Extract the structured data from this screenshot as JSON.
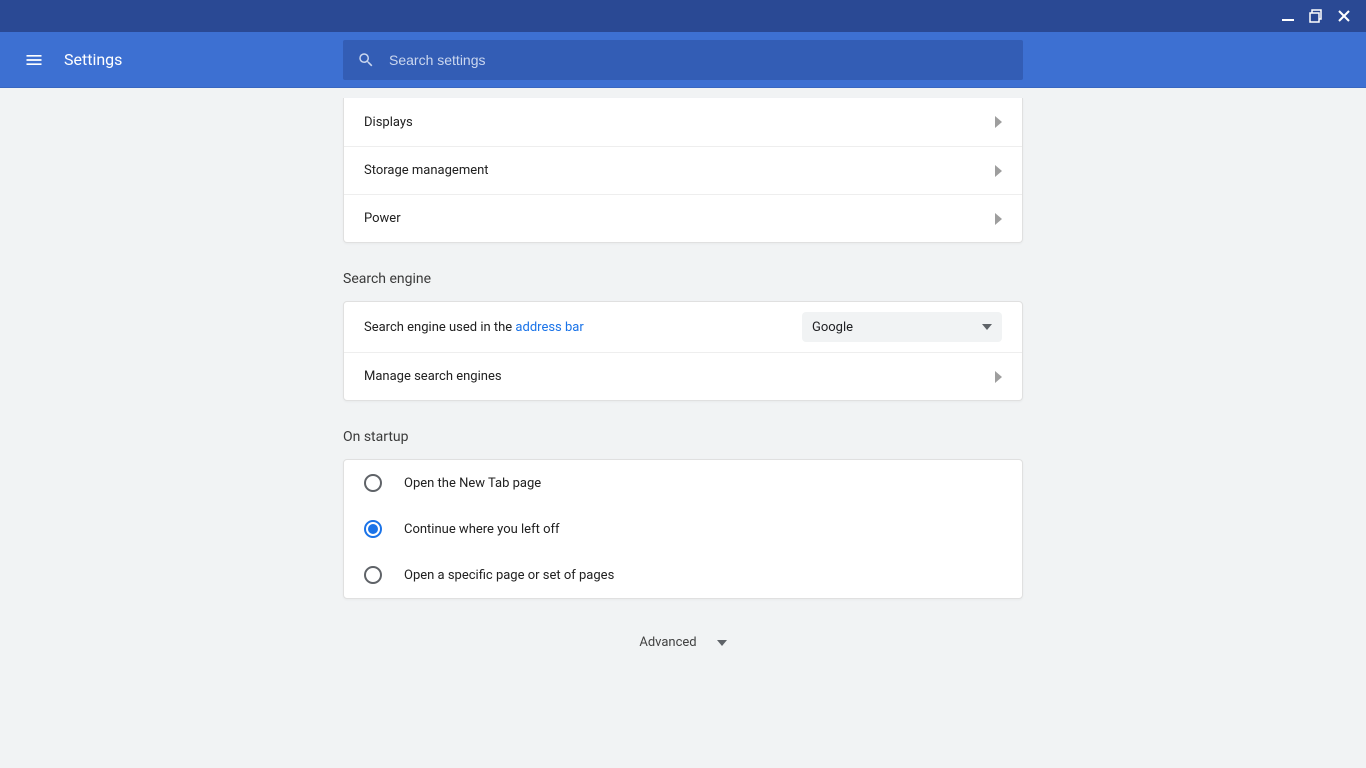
{
  "titlebar": {
    "minimize_tooltip": "Minimize",
    "maximize_tooltip": "Maximize",
    "close_tooltip": "Close"
  },
  "appbar": {
    "title": "Settings"
  },
  "search": {
    "placeholder": "Search settings"
  },
  "device": {
    "items": {
      "displays": "Displays",
      "storage": "Storage management",
      "power": "Power"
    }
  },
  "search_engine_section": {
    "title": "Search engine",
    "used_in_label_prefix": "Search engine used in the ",
    "used_in_link": "address bar",
    "dropdown_value": "Google",
    "manage_label": "Manage search engines"
  },
  "startup_section": {
    "title": "On startup",
    "options": {
      "new_tab": "Open the New Tab page",
      "continue": "Continue where you left off",
      "specific": "Open a specific page or set of pages"
    },
    "selected": "continue"
  },
  "advanced": {
    "label": "Advanced"
  }
}
